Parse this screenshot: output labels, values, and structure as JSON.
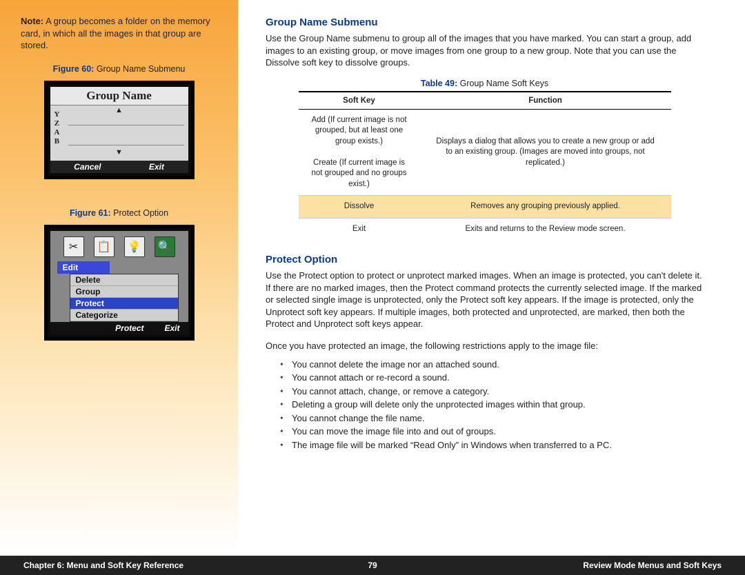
{
  "sidebar": {
    "note_label": "Note:",
    "note_text": " A group becomes a folder on the memory card, in which all the images in that group are stored.",
    "fig60_label": "Figure 60:",
    "fig60_text": " Group Name Submenu",
    "lcd1": {
      "title": "Group Name",
      "letters": [
        "Y",
        "Z",
        "A",
        "B"
      ],
      "soft_cancel": "Cancel",
      "soft_exit": "Exit"
    },
    "fig61_label": "Figure 61:",
    "fig61_text": " Protect Option",
    "lcd2": {
      "tab": "Edit",
      "menu": [
        "Delete",
        "Group",
        "Protect",
        "Categorize"
      ],
      "soft_protect": "Protect",
      "soft_exit": "Exit"
    }
  },
  "main": {
    "h_group": "Group Name Submenu",
    "p_group": "Use the Group Name submenu to group all of the images that you have marked. You can start a group, add images to an existing group, or move images from one group to a new group. Note that you can use the Dissolve soft key to dissolve groups.",
    "table": {
      "caption_label": "Table 49:",
      "caption_text": " Group Name Soft Keys",
      "headers": [
        "Soft Key",
        "Function"
      ],
      "rows": [
        {
          "key": "Add (If current image is not grouped, but at least one group exists.)\n\nCreate (If current image is not grouped and no groups exist.)",
          "fn": "Displays a dialog that allows you to create a new group or add to an existing group. (Images are moved into groups, not replicated.)"
        },
        {
          "key": "Dissolve",
          "fn": "Removes any grouping previously applied."
        },
        {
          "key": "Exit",
          "fn": "Exits and returns to the Review mode screen."
        }
      ]
    },
    "h_protect": "Protect Option",
    "p_protect1": "Use the Protect option to protect or unprotect marked images. When an image is protected, you can't delete it. If there are no marked images, then the Protect command protects the currently selected image. If the marked or selected single image is unprotected, only the Protect soft key appears. If the image is protected, only the Unprotect soft key appears. If multiple images, both protected and unprotected, are marked, then both the Protect and Unprotect soft keys appear.",
    "p_protect2": "Once you have protected an image, the following restrictions apply to the image file:",
    "restrictions": [
      "You cannot delete the image nor an attached sound.",
      "You cannot attach or re-record a sound.",
      "You cannot attach, change, or remove a category.",
      "Deleting a group will delete only the unprotected images within that group.",
      "You cannot change the file name.",
      "You can move the image file into and out of groups.",
      "The image file will be marked “Read Only” in Windows when transferred to a PC."
    ]
  },
  "footer": {
    "left": "Chapter 6: Menu and Soft Key Reference",
    "center": "79",
    "right": "Review Mode Menus and Soft Keys"
  }
}
